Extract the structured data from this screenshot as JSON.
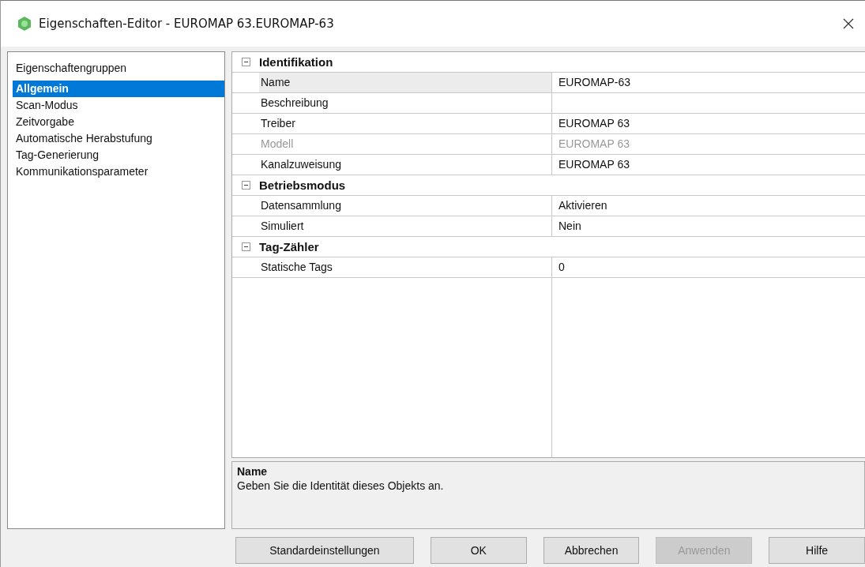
{
  "window": {
    "title": "Eigenschaften-Editor - EUROMAP 63.EUROMAP-63"
  },
  "sidebar": {
    "heading": "Eigenschaftengruppen",
    "items": [
      {
        "label": "Allgemein",
        "selected": true
      },
      {
        "label": "Scan-Modus",
        "selected": false
      },
      {
        "label": "Zeitvorgabe",
        "selected": false
      },
      {
        "label": "Automatische Herabstufung",
        "selected": false
      },
      {
        "label": "Tag-Generierung",
        "selected": false
      },
      {
        "label": "Kommunikationsparameter",
        "selected": false
      }
    ]
  },
  "property_grid": {
    "sections": [
      {
        "title": "Identifikation",
        "expanded": true,
        "rows": [
          {
            "label": "Name",
            "value": "EUROMAP-63",
            "selected": true,
            "disabled": false
          },
          {
            "label": "Beschreibung",
            "selected": false,
            "disabled": false
          },
          {
            "label": "Treiber",
            "value": "EUROMAP 63",
            "selected": false,
            "disabled": false
          },
          {
            "label": "Modell",
            "value": "EUROMAP 63",
            "selected": false,
            "disabled": true
          },
          {
            "label": "Kanalzuweisung",
            "value": "EUROMAP 63",
            "selected": false,
            "disabled": false
          }
        ]
      },
      {
        "title": "Betriebsmodus",
        "expanded": true,
        "rows": [
          {
            "label": "Datensammlung",
            "value": "Aktivieren",
            "selected": false,
            "disabled": false
          },
          {
            "label": "Simuliert",
            "value": "Nein",
            "selected": false,
            "disabled": false
          }
        ]
      },
      {
        "title": "Tag-Zähler",
        "expanded": true,
        "rows": [
          {
            "label": "Statische Tags",
            "value": "0",
            "selected": false,
            "disabled": false
          }
        ]
      }
    ]
  },
  "description": {
    "title": "Name",
    "text": "Geben Sie die Identität dieses Objekts an."
  },
  "buttons": [
    {
      "label": "Standardeinstellungen",
      "disabled": false
    },
    {
      "label": "OK",
      "disabled": false
    },
    {
      "label": "Abbrechen",
      "disabled": false
    },
    {
      "label": "Anwenden",
      "disabled": true
    },
    {
      "label": "Hilfe",
      "disabled": false
    }
  ]
}
